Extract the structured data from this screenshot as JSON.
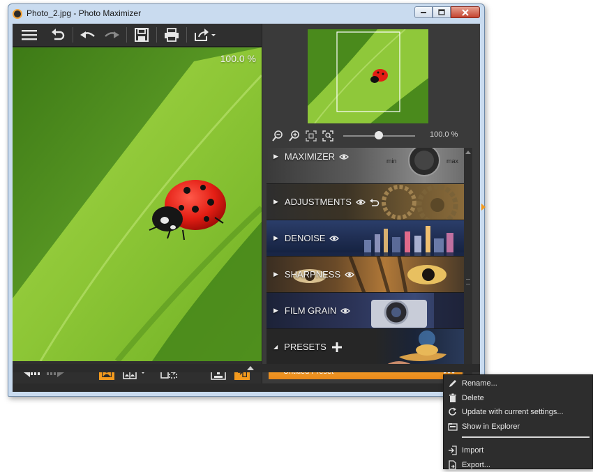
{
  "window": {
    "title": "Photo_2.jpg - Photo Maximizer",
    "controls": {
      "minimize": "minimize",
      "maximize": "maximize",
      "close": "close"
    }
  },
  "toolbar": {
    "icons": [
      "menu-icon",
      "reset-icon",
      "undo-icon",
      "redo-icon",
      "save-icon",
      "print-icon",
      "share-icon"
    ]
  },
  "canvas": {
    "zoom_label": "100.0 %"
  },
  "navigator": {
    "zoom_percent": "100.0 %",
    "zoom_slider_value": 0.5
  },
  "sections": [
    {
      "label": "MAXIMIZER",
      "extra": "eye",
      "knob_min": "min",
      "knob_max": "max"
    },
    {
      "label": "ADJUSTMENTS",
      "extra": "eye+reset"
    },
    {
      "label": "DENOISE",
      "extra": "eye"
    },
    {
      "label": "SHARPNESS",
      "extra": "eye"
    },
    {
      "label": "FILM GRAIN",
      "extra": "eye"
    },
    {
      "label": "PRESETS",
      "extra": "plus"
    }
  ],
  "presets": {
    "selected": "Untitled Preset",
    "more_label": "•••"
  },
  "context_menu": {
    "items": [
      "Rename...",
      "Delete",
      "Update with current settings...",
      "Show in Explorer"
    ],
    "items_after_separator": [
      "Import",
      "Export..."
    ]
  },
  "colors": {
    "accent": "#f39a1e",
    "panel_bg": "#3a3a3a",
    "toolbar_bg": "#2f2f2f"
  }
}
